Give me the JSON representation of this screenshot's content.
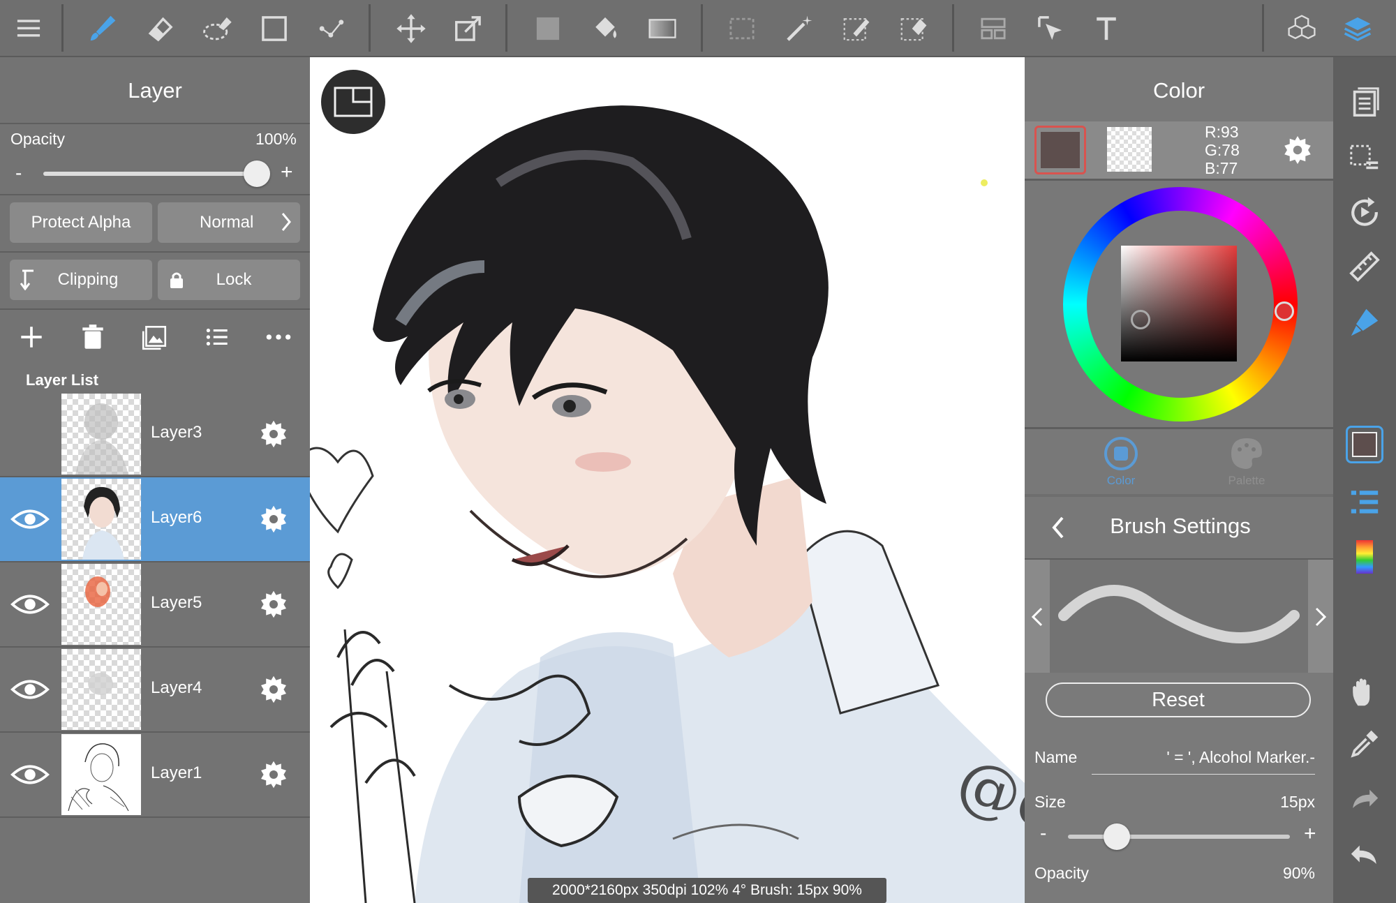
{
  "layer_panel": {
    "title": "Layer",
    "opacity_label": "Opacity",
    "opacity_value": "100%",
    "opacity_level": 1.0,
    "minus": "-",
    "plus": "+",
    "protect_alpha": "Protect Alpha",
    "blend_mode": "Normal",
    "clipping": "Clipping",
    "lock": "Lock",
    "layer_list_label": "Layer List",
    "layers": [
      {
        "name": "Layer3",
        "visible": false,
        "selected": false
      },
      {
        "name": "Layer6",
        "visible": true,
        "selected": true
      },
      {
        "name": "Layer5",
        "visible": true,
        "selected": false
      },
      {
        "name": "Layer4",
        "visible": true,
        "selected": false
      },
      {
        "name": "Layer1",
        "visible": true,
        "selected": false
      }
    ],
    "actions": [
      "add-icon",
      "trash-icon",
      "image-icon",
      "list-icon",
      "more-icon"
    ]
  },
  "toolbar": {
    "tools": [
      "menu-icon",
      "brush-icon",
      "eraser-icon",
      "blur-eraser-icon",
      "rectangle-icon",
      "dot-icon",
      "move-icon",
      "transform-icon",
      "fill-color-icon",
      "bucket-icon",
      "gradient-icon",
      "select-rect-icon",
      "magic-wand-icon",
      "select-pen-icon",
      "select-eraser-icon",
      "panel-layout-icon",
      "select-move-icon",
      "text-icon",
      "material-icon",
      "layers-icon"
    ]
  },
  "color_panel": {
    "title": "Color",
    "r": "R:93",
    "g": "G:78",
    "b": "B:77",
    "primary_color": "#5d4e4d",
    "tab_color": "Color",
    "tab_palette": "Palette"
  },
  "brush_panel": {
    "title": "Brush Settings",
    "reset": "Reset",
    "name_label": "Name",
    "name_value": "' = ', Alcohol Marker.-",
    "size_label": "Size",
    "size_value": "15px",
    "size_level": 0.22,
    "opacity_label": "Opacity",
    "opacity_value": "90%",
    "minus": "-",
    "plus": "+"
  },
  "status_bar": {
    "text": "2000*2160px 350dpi 102% 4° Brush: 15px 90%"
  },
  "canvas": {
    "watermark": "@eve"
  },
  "colors": {
    "accent": "#5b9bd5",
    "selected_layer": "#5b9bd5"
  }
}
